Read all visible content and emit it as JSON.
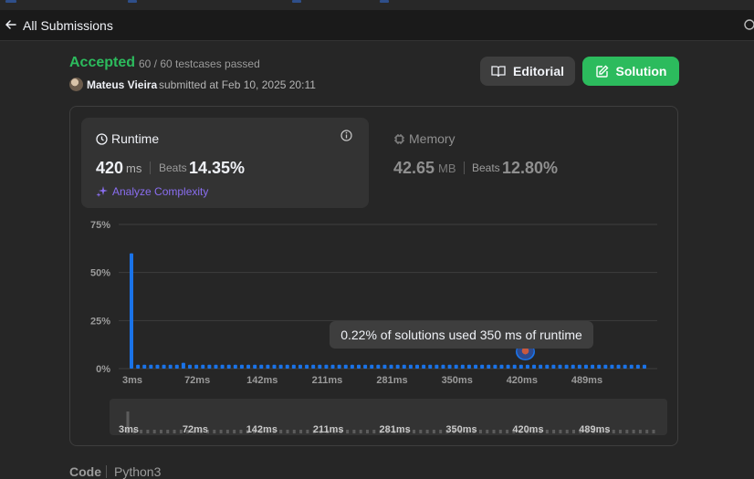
{
  "header": {
    "back_label": "All Submissions"
  },
  "submission": {
    "status": "Accepted",
    "testcases": "60 / 60 testcases passed",
    "author": "Mateus Vieira",
    "submitted_at": "submitted at Feb 10, 2025 20:11"
  },
  "buttons": {
    "editorial": "Editorial",
    "solution": "Solution"
  },
  "runtime": {
    "label": "Runtime",
    "value": "420",
    "unit": "ms",
    "beats_label": "Beats",
    "beats_pct": "14.35%",
    "analyze": "Analyze Complexity"
  },
  "memory": {
    "label": "Memory",
    "value": "42.65",
    "unit": "MB",
    "beats_label": "Beats",
    "beats_pct": "12.80%"
  },
  "tooltip": "0.22% of solutions used 350 ms of runtime",
  "code": {
    "label": "Code",
    "language": "Python3"
  },
  "colors": {
    "accent_green": "#2cbb5d",
    "bar_blue": "#1a73e8",
    "purple": "#8a6ef0"
  },
  "chart_data": {
    "type": "bar",
    "y_ticks": [
      "75%",
      "50%",
      "25%",
      "0%"
    ],
    "ylim": [
      0,
      75
    ],
    "x_tick_labels": [
      "3ms",
      "72ms",
      "142ms",
      "211ms",
      "281ms",
      "350ms",
      "420ms",
      "489ms"
    ],
    "x_tick_bar_index": [
      0,
      10,
      20,
      30,
      40,
      50,
      60,
      70
    ],
    "values": [
      60,
      2,
      2,
      2,
      2,
      2,
      2,
      2,
      3,
      2,
      2,
      2,
      2,
      2,
      2,
      2,
      2,
      2,
      2,
      2,
      2,
      2,
      2,
      2,
      2,
      2,
      2,
      2,
      2,
      2,
      2,
      2,
      2,
      2,
      2,
      2,
      2,
      2,
      2,
      2,
      2,
      2,
      2,
      2,
      2,
      2,
      2,
      2,
      2,
      2,
      2,
      2,
      2,
      2,
      2,
      2,
      2,
      2,
      2,
      2,
      2,
      2,
      2,
      2,
      2,
      2,
      2,
      2,
      2,
      2,
      2,
      2,
      2,
      2,
      2,
      2,
      2,
      2,
      2,
      2
    ],
    "highlight_index": 60,
    "grid": true
  }
}
